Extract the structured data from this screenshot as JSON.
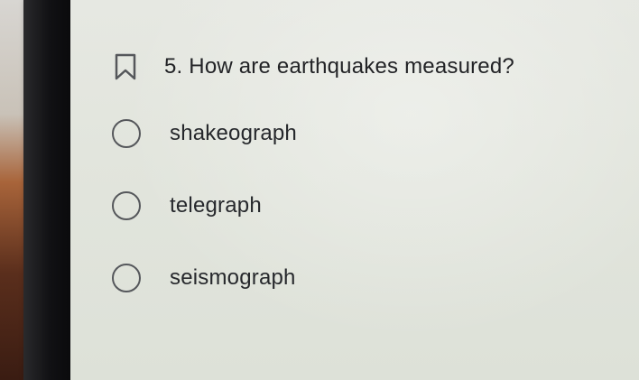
{
  "question": {
    "number_and_text": "5. How are earthquakes measured?",
    "icon": "bookmark-icon"
  },
  "options": [
    {
      "label": "shakeograph",
      "selected": false
    },
    {
      "label": "telegraph",
      "selected": false
    },
    {
      "label": "seismograph",
      "selected": false
    }
  ],
  "colors": {
    "text": "#222326",
    "radio_border": "#55575b",
    "screen_bg": "#e2e5dd",
    "bezel": "#111114"
  }
}
